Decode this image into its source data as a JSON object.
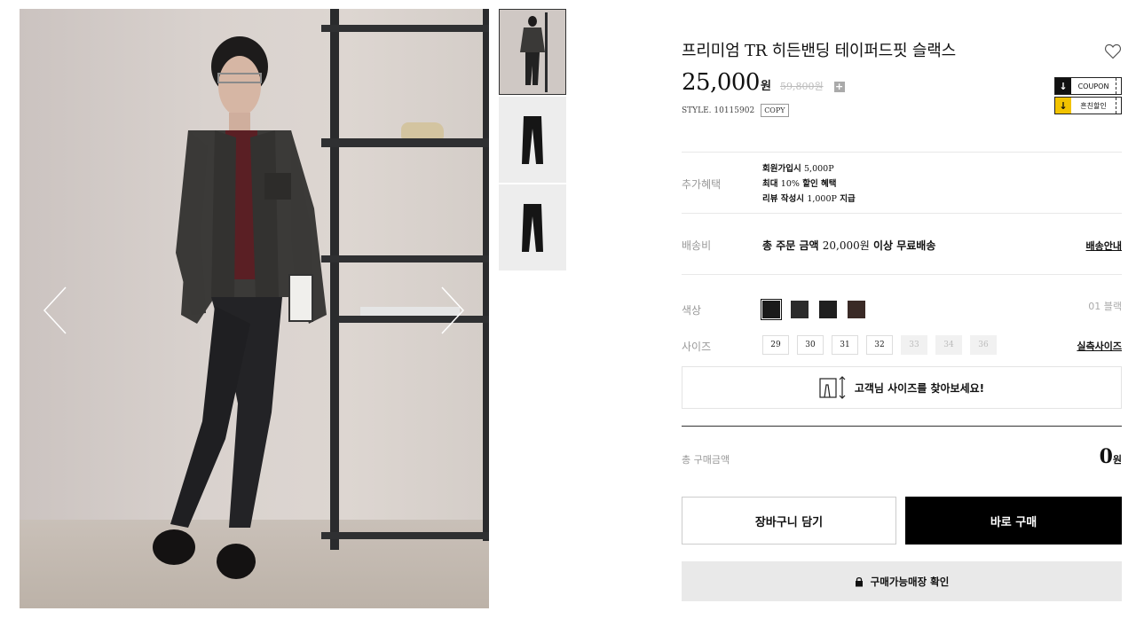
{
  "gallery": {
    "main_image": "model-wearing-slacks-photo",
    "thumbnails": [
      "model-full-body",
      "slacks-front",
      "slacks-back"
    ],
    "prev_icon": "chevron-left-icon",
    "next_icon": "chevron-right-icon"
  },
  "product": {
    "title": "프리미엄 TR 히든밴딩 테이퍼드핏 슬랙스",
    "price": "25,000",
    "price_unit": "원",
    "original_price": "59,800원",
    "plus_label": "+",
    "style_code": "STYLE. 10115902",
    "copy_label": "COPY",
    "wish_icon": "heart-icon"
  },
  "coupons": [
    {
      "icon": "download-icon",
      "label": "COUPON",
      "bg": "#111111"
    },
    {
      "icon": "download-icon",
      "label": "흔친할인",
      "bg": "#f2c300"
    }
  ],
  "benefits": {
    "label": "추가혜택",
    "items": [
      {
        "text": "회원가입시",
        "value": "5,000P"
      },
      {
        "text": "최대",
        "value": "10%",
        "suffix": "할인 혜택"
      },
      {
        "text": "리뷰 작성시",
        "value": "1,000P",
        "suffix": "지급"
      }
    ]
  },
  "shipping": {
    "label": "배송비",
    "text_prefix": "총 주문 금액",
    "amount": "20,000원",
    "text_suffix": "이상 무료배송",
    "link": "배송안내"
  },
  "color": {
    "label": "색상",
    "selected_name": "01 블랙",
    "swatches": [
      "#1a1a1a",
      "#2b2b2b",
      "#1f1f1f",
      "#3a2a26"
    ]
  },
  "size": {
    "label": "사이즈",
    "link": "실측사이즈",
    "options": [
      {
        "label": "29",
        "soldout": false
      },
      {
        "label": "30",
        "soldout": false
      },
      {
        "label": "31",
        "soldout": false
      },
      {
        "label": "32",
        "soldout": false
      },
      {
        "label": "33",
        "soldout": true
      },
      {
        "label": "34",
        "soldout": true
      },
      {
        "label": "36",
        "soldout": true
      }
    ],
    "finder_label": "고객님 사이즈를 찾아보세요!",
    "finder_icon": "size-measure-icon"
  },
  "total": {
    "label": "총 구매금액",
    "value": "0",
    "unit": "원"
  },
  "actions": {
    "cart_label": "장바구니 담기",
    "buy_label": "바로 구매",
    "store_label": "구매가능매장 확인",
    "store_icon": "lock-icon"
  }
}
